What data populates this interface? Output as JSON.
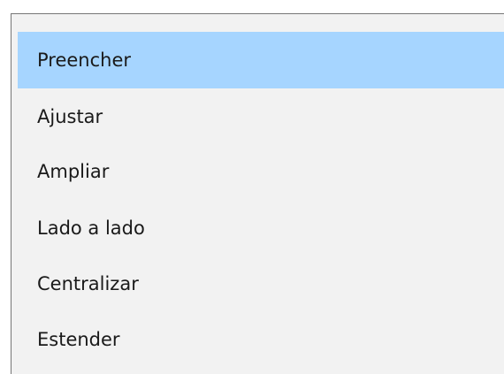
{
  "dropdown": {
    "selected_index": 0,
    "selected_color": "#a6d5ff",
    "background_color": "#f2f2f2",
    "options": [
      {
        "label": "Preencher"
      },
      {
        "label": "Ajustar"
      },
      {
        "label": "Ampliar"
      },
      {
        "label": "Lado a lado"
      },
      {
        "label": "Centralizar"
      },
      {
        "label": "Estender"
      }
    ]
  }
}
